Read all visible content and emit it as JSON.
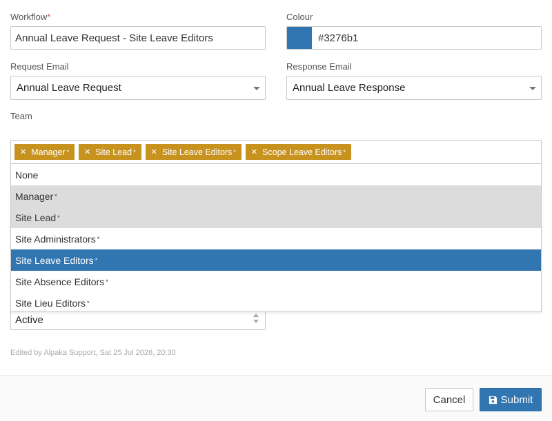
{
  "workflow": {
    "label": "Workflow",
    "required_mark": "*",
    "value": "Annual Leave Request - Site Leave Editors"
  },
  "colour": {
    "label": "Colour",
    "value": "#3276b1",
    "swatch_color": "#3276b1"
  },
  "request_email": {
    "label": "Request Email",
    "value": "Annual Leave Request"
  },
  "response_email": {
    "label": "Response Email",
    "value": "Annual Leave Response"
  },
  "team": {
    "label": "Team",
    "tags": [
      {
        "label": "Manager",
        "mark": "*"
      },
      {
        "label": "Site Lead",
        "mark": "*"
      },
      {
        "label": "Site Leave Editors",
        "mark": "*"
      },
      {
        "label": "Scope Leave Editors",
        "mark": "*"
      }
    ],
    "options": [
      {
        "label": "None",
        "mark": ""
      },
      {
        "label": "Manager",
        "mark": "*"
      },
      {
        "label": "Site Lead",
        "mark": "*"
      },
      {
        "label": "Site Administrators",
        "mark": "*"
      },
      {
        "label": "Site Leave Editors",
        "mark": "*"
      },
      {
        "label": "Site Absence Editors",
        "mark": "*"
      },
      {
        "label": "Site Lieu Editors",
        "mark": "*"
      }
    ]
  },
  "status": {
    "value": "Active"
  },
  "meta": {
    "edited_by": "Edited by Alpaka Support, Sat 25 Jul 2026, 20:30"
  },
  "footer": {
    "cancel_label": "Cancel",
    "submit_label": "Submit"
  },
  "colors": {
    "tag": "#c8921f",
    "highlight": "#3276b1",
    "selected": "#dcdcdc",
    "required": "#d9534f"
  },
  "icons": {
    "remove": "times-icon",
    "submit": "save-icon"
  }
}
